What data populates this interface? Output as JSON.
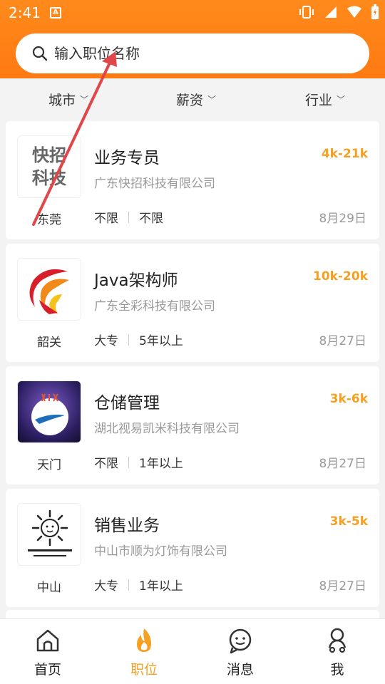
{
  "status": {
    "time": "2:41",
    "badge": "A"
  },
  "search": {
    "placeholder": "输入职位名称"
  },
  "filters": [
    "城市",
    "薪资",
    "行业"
  ],
  "jobs": [
    {
      "title": "业务专员",
      "salary": "4k-21k",
      "company": "广东快招科技有限公司",
      "city": "东莞",
      "edu": "不限",
      "exp": "不限",
      "date": "8月29日",
      "logo_text": [
        "快招",
        "科技"
      ]
    },
    {
      "title": "Java架构师",
      "salary": "10k-20k",
      "company": "广东全彩科技有限公司",
      "city": "韶关",
      "edu": "大专",
      "exp": "5年以上",
      "date": "8月27日"
    },
    {
      "title": "仓储管理",
      "salary": "3k-6k",
      "company": "湖北视易凯米科技有限公司",
      "city": "天门",
      "edu": "不限",
      "exp": "1年以上",
      "date": "8月27日"
    },
    {
      "title": "销售业务",
      "salary": "3k-5k",
      "company": "中山市顺为灯饰有限公司",
      "city": "中山",
      "edu": "大专",
      "exp": "1年以上",
      "date": "8月27日"
    }
  ],
  "tabs": [
    {
      "label": "首页",
      "icon": "home-icon"
    },
    {
      "label": "职位",
      "icon": "fire-icon"
    },
    {
      "label": "消息",
      "icon": "chat-icon"
    },
    {
      "label": "我",
      "icon": "user-icon"
    }
  ],
  "colors": {
    "accent": "#ff7a12",
    "salary": "#f5a020"
  }
}
